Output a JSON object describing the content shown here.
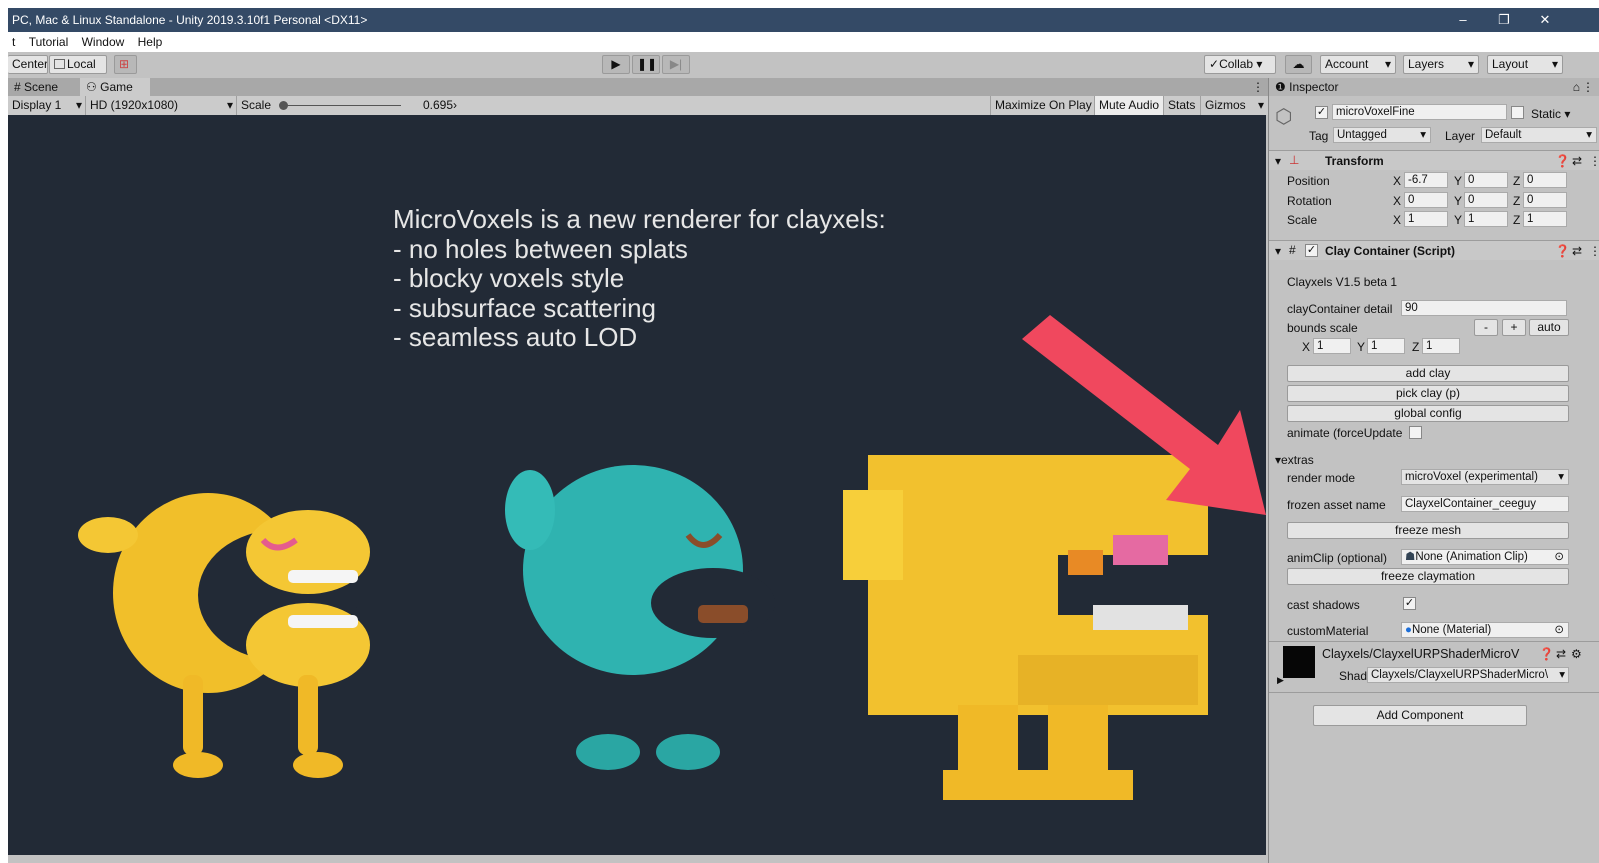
{
  "window": {
    "title": "PC, Mac & Linux Standalone - Unity 2019.3.10f1 Personal <DX11>",
    "min": "–",
    "restore": "❐",
    "close": "✕"
  },
  "menu": [
    "t",
    "Tutorial",
    "Window",
    "Help"
  ],
  "toolbar": {
    "pivot": "Center",
    "space": "Local",
    "collab": "Collab ▾",
    "account": "Account",
    "layers": "Layers",
    "layout": "Layout"
  },
  "tabs": {
    "scene": "Scene",
    "game": "Game"
  },
  "gamebar": {
    "display": "Display 1",
    "resolution": "HD (1920x1080)",
    "scale_label": "Scale",
    "scale_value": "0.695›",
    "maximize": "Maximize On Play",
    "mute": "Mute Audio",
    "stats": "Stats",
    "gizmos": "Gizmos"
  },
  "overlay": {
    "lines": [
      "MicroVoxels is a new renderer for clayxels:",
      "- no holes between splats",
      "- blocky voxels style",
      "- subsurface scattering",
      "- seamless auto LOD"
    ]
  },
  "inspector": {
    "tab": "Inspector",
    "object_name": "microVoxelFine",
    "static": "Static",
    "tag_label": "Tag",
    "tag": "Untagged",
    "layer_label": "Layer",
    "layer": "Default",
    "transform": {
      "title": "Transform",
      "position": {
        "label": "Position",
        "x": "-6.7",
        "y": "0",
        "z": "0"
      },
      "rotation": {
        "label": "Rotation",
        "x": "0",
        "y": "0",
        "z": "0"
      },
      "scale": {
        "label": "Scale",
        "x": "1",
        "y": "1",
        "z": "1"
      }
    },
    "clay": {
      "title": "Clay Container (Script)",
      "version": "Clayxels V1.5 beta 1",
      "detail_label": "clayContainer detail",
      "detail": "90",
      "bounds_label": "bounds scale",
      "minus": "-",
      "plus": "+",
      "auto": "auto",
      "bx": "1",
      "by": "1",
      "bz": "1",
      "add_clay": "add clay",
      "pick_clay": "pick clay (p)",
      "global_config": "global config",
      "animate_label": "animate (forceUpdate",
      "extras": "extras",
      "render_mode_label": "render mode",
      "render_mode": "microVoxel (experimental)",
      "frozen_label": "frozen asset name",
      "frozen": "ClayxelContainer_ceeguy",
      "freeze_mesh": "freeze mesh",
      "anim_label": "animClip (optional)",
      "anim": "None (Animation Clip)",
      "freeze_claymation": "freeze claymation",
      "shadows_label": "cast shadows",
      "material_label": "customMaterial",
      "material": "None (Material)"
    },
    "shader": {
      "name": "Clayxels/ClayxelURPShaderMicroV",
      "label": "Shader",
      "value": "Clayxels/ClayxelURPShaderMicro\\"
    },
    "add_component": "Add Component"
  },
  "colors": {
    "titlebar": "#344a66",
    "viewport": "#222a36",
    "arrow": "#f0485e",
    "yellow": "#f2c12e",
    "teal": "#2fb3b0"
  }
}
